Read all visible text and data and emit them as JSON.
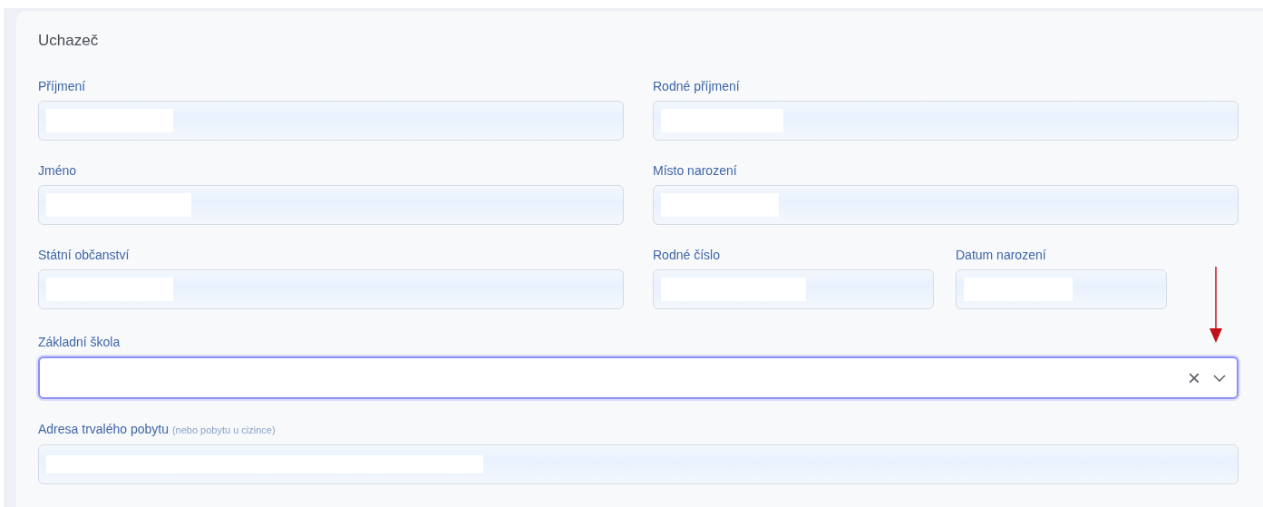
{
  "section": {
    "title": "Uchazeč"
  },
  "rows": [
    {
      "fields": [
        {
          "label": "Příjmení",
          "redacted": true
        },
        {
          "label": "Rodné příjmení",
          "redacted": true
        }
      ]
    },
    {
      "fields": [
        {
          "label": "Jméno",
          "redacted": true
        },
        {
          "label": "Místo narození",
          "redacted": true
        }
      ]
    },
    {
      "fields": [
        {
          "label": "Státní občanství",
          "redacted": true
        },
        {
          "label": "Rodné číslo",
          "redacted": true
        },
        {
          "label": "Datum narození",
          "redacted": true
        }
      ]
    }
  ],
  "school": {
    "label": "Základní škola",
    "focused": true,
    "clear_symbol": "×",
    "annotated": true
  },
  "address": {
    "label": "Adresa trvalého pobytu",
    "hint": "(nebo pobytu u cizince)",
    "redacted": true
  }
}
